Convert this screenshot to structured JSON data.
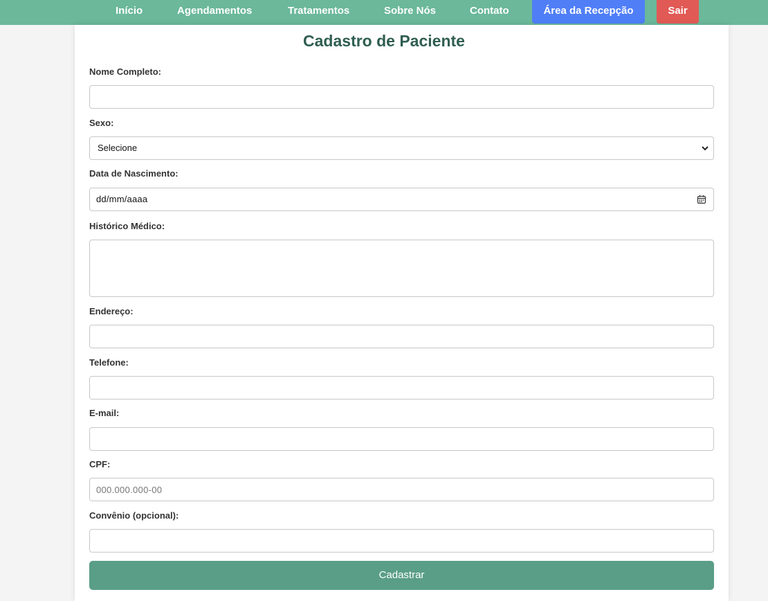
{
  "nav": {
    "links": [
      "Início",
      "Agendamentos",
      "Tratamentos",
      "Sobre Nós",
      "Contato"
    ],
    "reception_label": "Área da Recepção",
    "logout_label": "Sair"
  },
  "colors": {
    "navbar": "#6bb89a",
    "reception_button": "#4f7ef7",
    "logout_button": "#e15a55",
    "title": "#2f5e51",
    "submit_button": "#5a9e87"
  },
  "form": {
    "title": "Cadastro de Paciente",
    "name_label": "Nome Completo:",
    "name_value": "",
    "sex_label": "Sexo:",
    "sex_selected": "Selecione",
    "birth_label": "Data de Nascimento:",
    "birth_value": "dd/mm/aaaa",
    "history_label": "Histórico Médico:",
    "history_value": "",
    "address_label": "Endereço:",
    "address_value": "",
    "phone_label": "Telefone:",
    "phone_value": "",
    "email_label": "E-mail:",
    "email_value": "",
    "cpf_label": "CPF:",
    "cpf_placeholder": "000.000.000-00",
    "insurance_label": "Convênio (opcional):",
    "insurance_value": "",
    "submit_label": "Cadastrar"
  },
  "icons": {
    "select_arrow": "chevron-down-icon",
    "date_picker": "calendar-icon"
  }
}
